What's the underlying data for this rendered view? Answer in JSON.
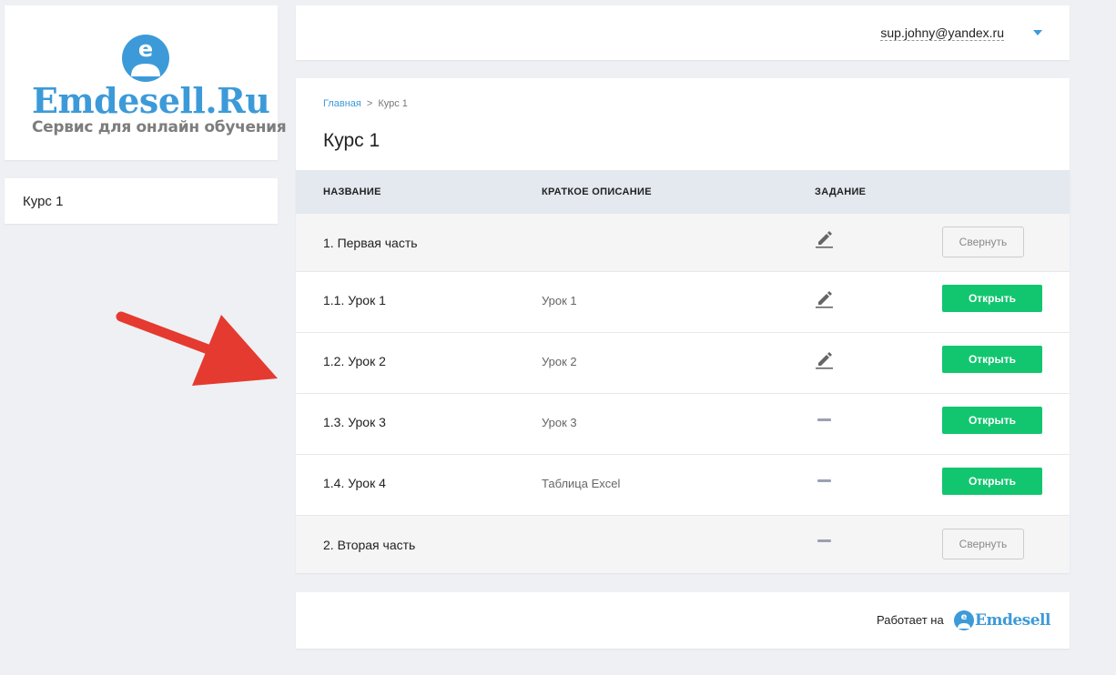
{
  "brand": {
    "name": "Emdesell.Ru",
    "tagline": "Сервис для онлайн обучения",
    "color": "#3d9ad9"
  },
  "sidebar": {
    "items": [
      {
        "label": "Курс 1"
      }
    ]
  },
  "header": {
    "user_email": "sup.johny@yandex.ru"
  },
  "breadcrumb": {
    "home": "Главная",
    "separator": ">",
    "current": "Курс 1"
  },
  "page_title": "Курс 1",
  "table": {
    "headers": [
      "НАЗВАНИЕ",
      "КРАТКОЕ ОПИСАНИЕ",
      "ЗАДАНИЕ"
    ],
    "rows": [
      {
        "type": "part",
        "title": "1. Первая часть",
        "description": "",
        "task": "edit-icon",
        "action": "Свернуть"
      },
      {
        "type": "lesson",
        "title": "1.1. Урок 1",
        "description": "Урок 1",
        "task": "edit-icon",
        "action": "Открыть"
      },
      {
        "type": "lesson",
        "title": "1.2. Урок 2",
        "description": "Урок 2",
        "task": "edit-icon",
        "action": "Открыть"
      },
      {
        "type": "lesson",
        "title": "1.3. Урок 3",
        "description": "Урок 3",
        "task": "dash-icon",
        "action": "Открыть"
      },
      {
        "type": "lesson",
        "title": "1.4. Урок 4",
        "description": "Таблица Excel",
        "task": "dash-icon",
        "action": "Открыть"
      },
      {
        "type": "part",
        "title": "2. Вторая часть",
        "description": "",
        "task": "dash-icon",
        "action": "Свернуть"
      }
    ]
  },
  "footer": {
    "powered_by": "Работает на",
    "brand": "Emdesell"
  },
  "colors": {
    "open_button": "#12c66f",
    "annotation_arrow": "#e53a2f"
  }
}
